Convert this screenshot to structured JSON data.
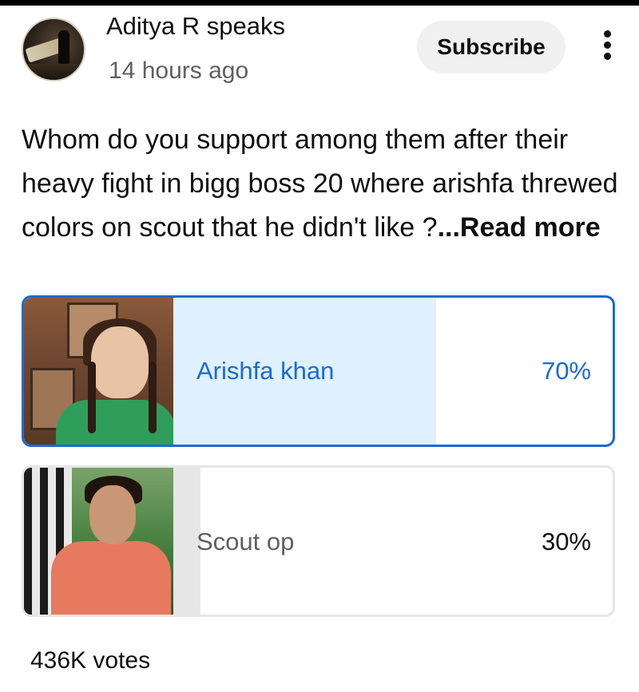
{
  "post": {
    "channel_name": "Aditya R speaks",
    "timestamp": "14 hours ago",
    "subscribe_label": "Subscribe",
    "avatar_text": "Aditya R Speaks",
    "question": "Whom do you support among them after their heavy fight in bigg boss 20 where arishfa threwed colors on scout that he didn't like ?",
    "read_more": "...Read more"
  },
  "poll": {
    "options": [
      {
        "label": "Arishfa khan",
        "percent_text": "70%",
        "share": 0.7,
        "selected": true
      },
      {
        "label": "Scout op",
        "percent_text": "30%",
        "share": 0.3,
        "selected": false
      }
    ],
    "votes": "436K votes"
  },
  "colors": {
    "accent": "#1a6ad6",
    "selected_fill": "#dff0ff",
    "unselected_fill": "#e6e6e6",
    "subscribe_bg": "#f0f0f0"
  },
  "icons": {
    "menu": "kebab-menu-icon"
  }
}
